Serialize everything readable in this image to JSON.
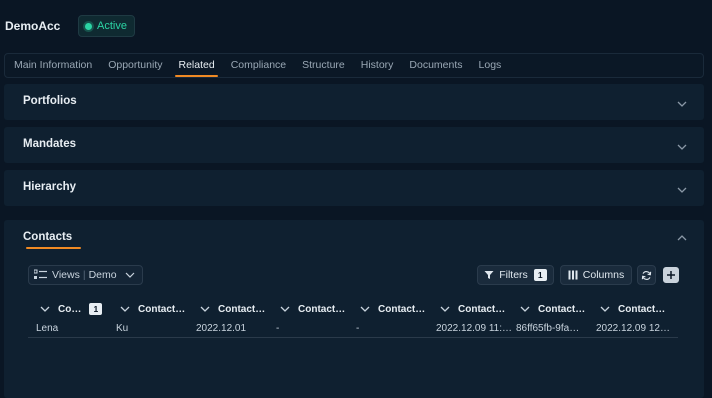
{
  "header": {
    "account_name": "DemoAcc",
    "status": "Active",
    "status_color": "#2bd4a4"
  },
  "tabs": [
    {
      "label": "Main Information",
      "active": false
    },
    {
      "label": "Opportunity",
      "active": false
    },
    {
      "label": "Related",
      "active": true
    },
    {
      "label": "Compliance",
      "active": false
    },
    {
      "label": "Structure",
      "active": false
    },
    {
      "label": "History",
      "active": false
    },
    {
      "label": "Documents",
      "active": false
    },
    {
      "label": "Logs",
      "active": false
    }
  ],
  "accent_color": "#f08a24",
  "sections": {
    "portfolios": {
      "title": "Portfolios",
      "expanded": false
    },
    "mandates": {
      "title": "Mandates",
      "expanded": false
    },
    "hierarchy": {
      "title": "Hierarchy",
      "expanded": false
    },
    "contacts": {
      "title": "Contacts",
      "expanded": true
    }
  },
  "toolbar": {
    "views_label": "Views",
    "view_name": "Demo",
    "filters_label": "Filters",
    "filters_count": "1",
    "columns_label": "Columns"
  },
  "table": {
    "columns": [
      {
        "label": "Co…",
        "badge": "1"
      },
      {
        "label": "Contact…"
      },
      {
        "label": "Contact…"
      },
      {
        "label": "Contact…"
      },
      {
        "label": "Contact…"
      },
      {
        "label": "Contact…"
      },
      {
        "label": "Contact…"
      },
      {
        "label": "Contact…"
      }
    ],
    "rows": [
      [
        "Lena",
        "Ku",
        "2022.12.01",
        "-",
        "-",
        "2022.12.09 11:…",
        "86ff65fb-9fa…",
        "2022.12.09 12…"
      ]
    ]
  }
}
